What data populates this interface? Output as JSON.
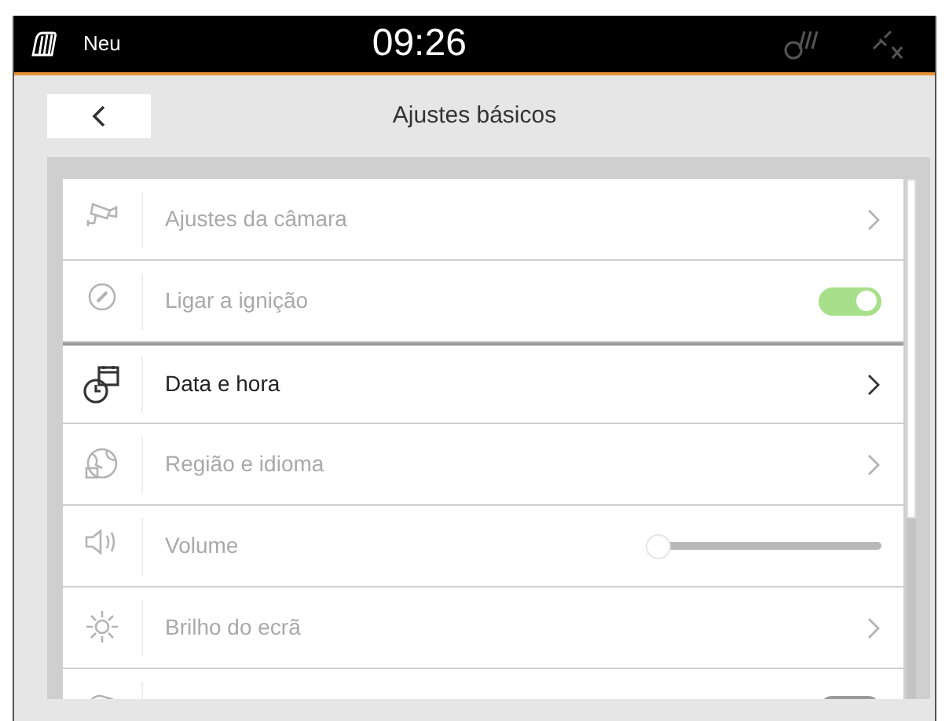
{
  "status_bar": {
    "profile": "Neu",
    "time": "09:26"
  },
  "header": {
    "title": "Ajustes básicos"
  },
  "settings": [
    {
      "kind": "link",
      "label": "Ajustes da câmara",
      "disabled": true,
      "selected": false
    },
    {
      "kind": "toggle",
      "label": "Ligar a ignição",
      "disabled": true,
      "selected": false,
      "on": true
    },
    {
      "kind": "link",
      "label": "Data e hora",
      "disabled": false,
      "selected": true
    },
    {
      "kind": "link",
      "label": "Região e idioma",
      "disabled": true,
      "selected": false
    },
    {
      "kind": "slider",
      "label": "Volume",
      "disabled": true,
      "selected": false,
      "level": 0
    },
    {
      "kind": "link",
      "label": "Brilho do ecrã",
      "disabled": true,
      "selected": false
    },
    {
      "kind": "toggle",
      "disabled": true,
      "selected": false,
      "on": false
    }
  ]
}
